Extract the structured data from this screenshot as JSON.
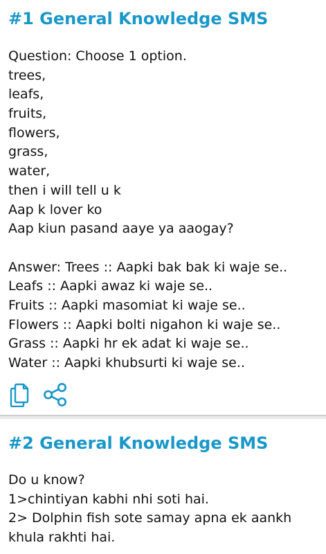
{
  "cards": [
    {
      "title": "#1 General Knowledge SMS",
      "question": [
        "Question: Choose 1 option.",
        "trees,",
        "leafs,",
        "fruits,",
        "flowers,",
        "grass,",
        "water,",
        "then i will tell u k",
        "Aap k lover ko",
        "Aap kiun pasand aaye ya aaogay?"
      ],
      "answer": [
        "Answer: Trees :: Aapki bak bak ki waje se..",
        "Leafs :: Aapki awaz ki waje se..",
        "Fruits :: Aapki masomiat ki waje se..",
        "Flowers :: Aapki bolti nigahon ki waje se..",
        "Grass :: Aapki hr ek adat ki waje se..",
        "Water :: Aapki khubsurti ki waje se.."
      ],
      "actions": [
        {
          "icon": "copy-icon"
        },
        {
          "icon": "share-icon"
        }
      ]
    },
    {
      "title": "#2 General Knowledge SMS",
      "lines": [
        "Do u know?",
        "1>chintiyan kabhi nhi soti hai.",
        "2> Dolphin fish sote samay apna ek aankh",
        "khula rakhti hai."
      ]
    }
  ],
  "colors": {
    "accent": "#1a97c9",
    "text": "#111111",
    "background": "#e8e8e8",
    "card": "#ffffff"
  }
}
